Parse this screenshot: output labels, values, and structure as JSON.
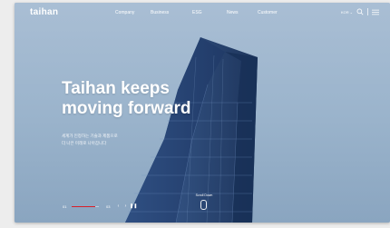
{
  "header": {
    "logo": "taihan",
    "nav": [
      "Company",
      "Business",
      "ESG",
      "News",
      "Customer"
    ],
    "lang": "KOR"
  },
  "hero": {
    "headline_line1": "Taihan keeps",
    "headline_line2": "moving forward",
    "sub_line1": "세계가 인정하는 기술과 제품으로",
    "sub_line2": "더 나은 미래로 나아갑니다"
  },
  "slider": {
    "current": "01",
    "total": "03",
    "progress": 0.85
  },
  "scroll": {
    "label": "Scroll Down"
  },
  "side_dock": {
    "icons": [
      "flag-icon",
      "globe-icon",
      "calendar-icon",
      "chat-icon"
    ],
    "accent": "#d8202a"
  },
  "colors": {
    "accent": "#d8202a",
    "dock": "#26282b"
  }
}
